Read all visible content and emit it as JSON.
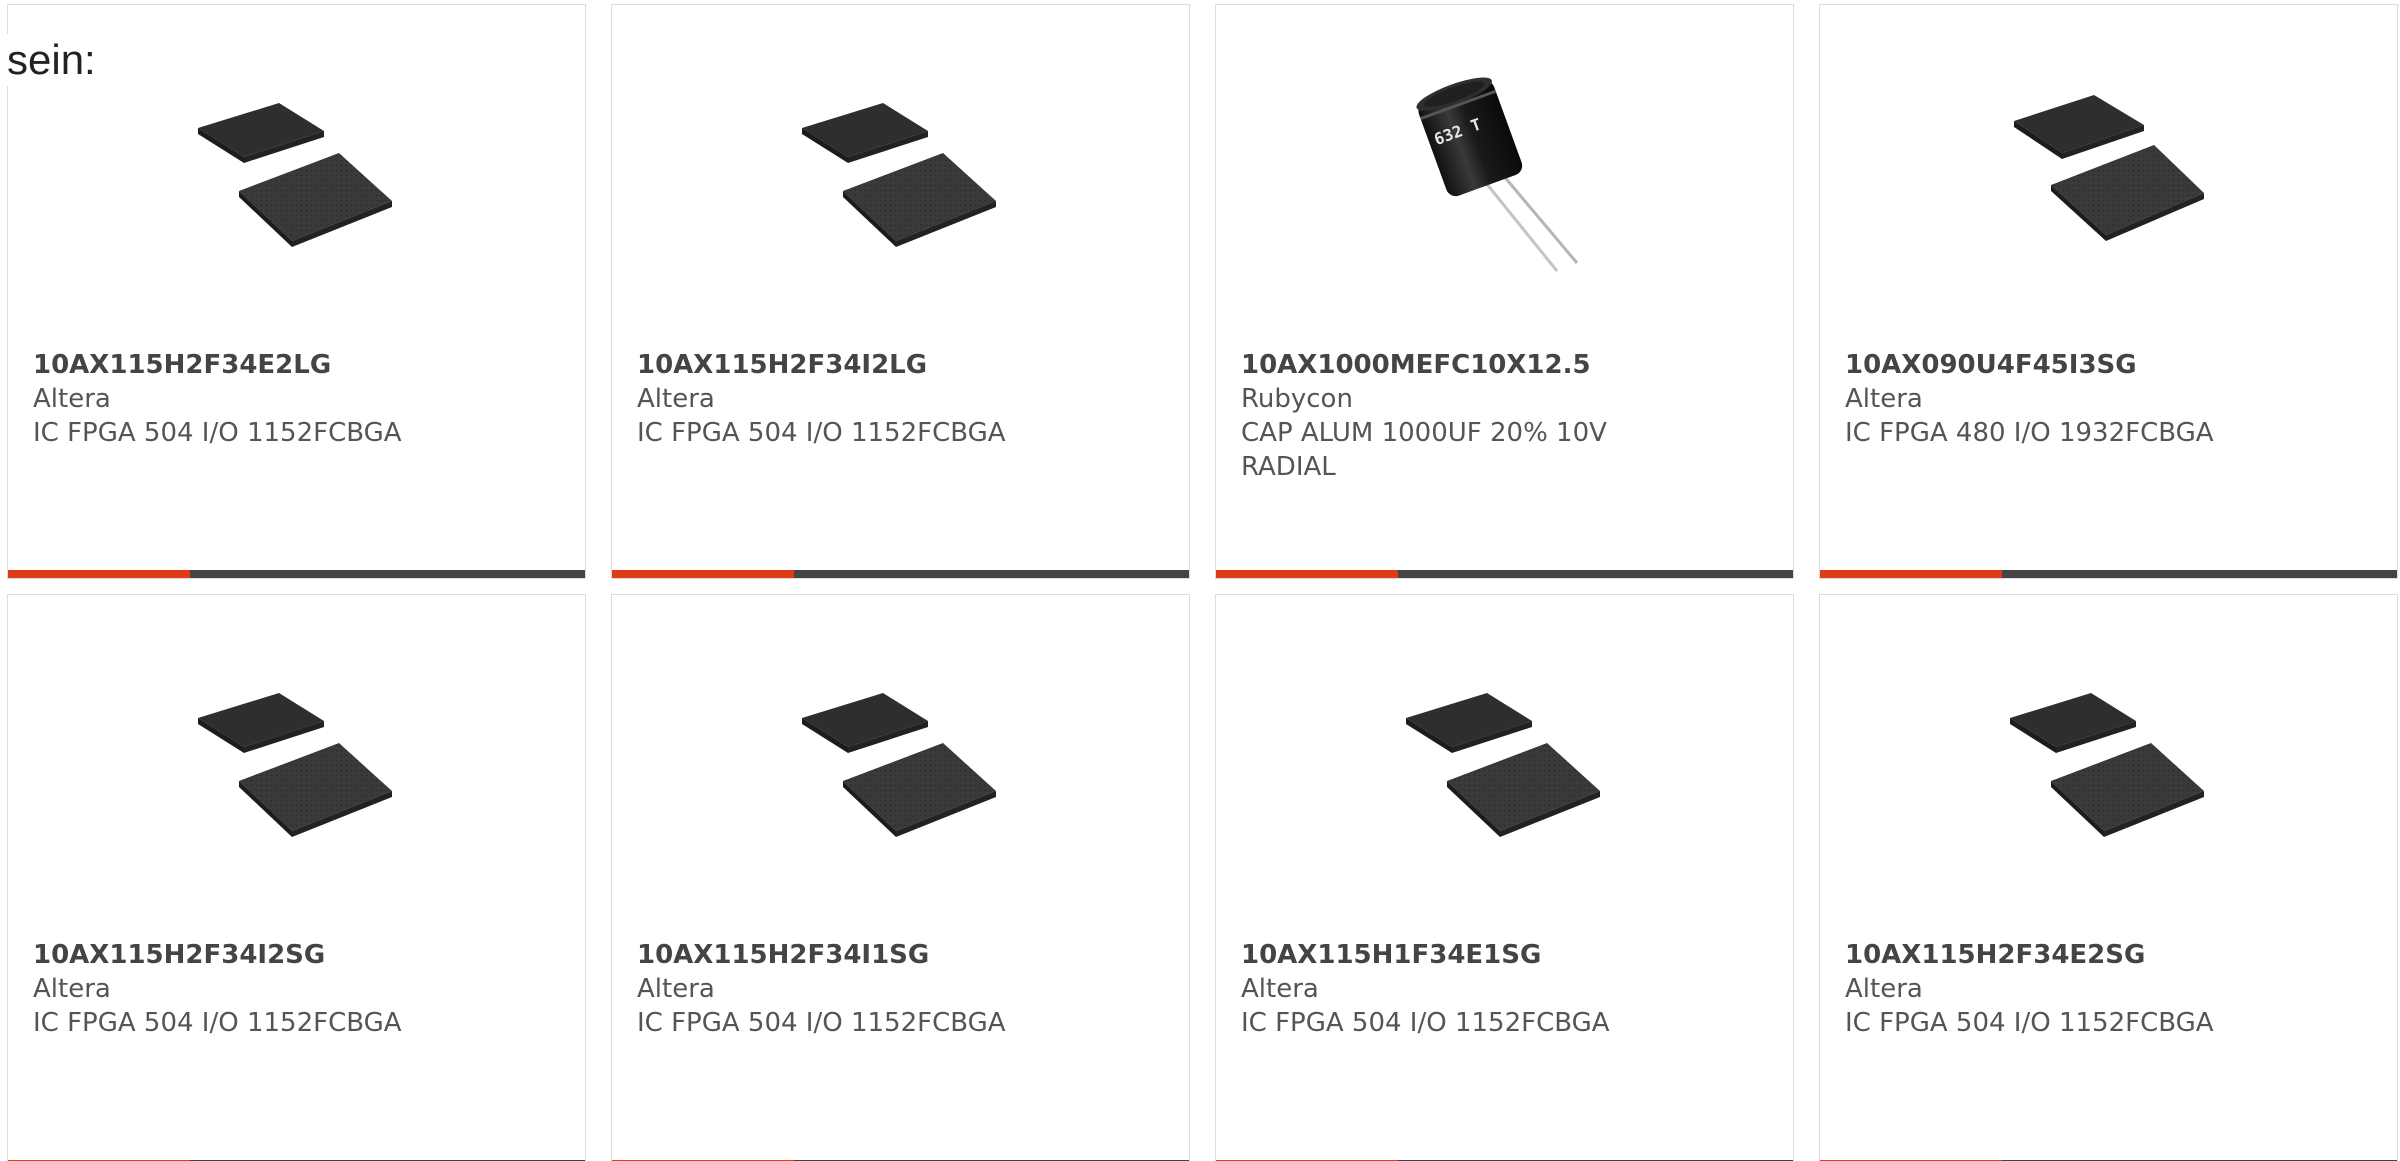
{
  "intro_text": "sein:",
  "colors": {
    "accent": "#e03b15",
    "bar": "#444444",
    "border": "#dcdcdc"
  },
  "products": [
    {
      "part_number": "10AX115H2F34E2LG",
      "manufacturer": "Altera",
      "description": "IC FPGA 504 I/O 1152FCBGA",
      "image_icon": "fpga-chip-icon"
    },
    {
      "part_number": "10AX115H2F34I2LG",
      "manufacturer": "Altera",
      "description": "IC FPGA 504 I/O 1152FCBGA",
      "image_icon": "fpga-chip-icon"
    },
    {
      "part_number": "10AX1000MEFC10X12.5",
      "manufacturer": "Rubycon",
      "description": "CAP ALUM 1000UF 20% 10V RADIAL",
      "image_icon": "capacitor-icon"
    },
    {
      "part_number": "10AX090U4F45I3SG",
      "manufacturer": "Altera",
      "description": "IC FPGA 480 I/O 1932FCBGA",
      "image_icon": "fpga-chip-icon"
    },
    {
      "part_number": "10AX115H2F34I2SG",
      "manufacturer": "Altera",
      "description": "IC FPGA 504 I/O 1152FCBGA",
      "image_icon": "fpga-chip-icon"
    },
    {
      "part_number": "10AX115H2F34I1SG",
      "manufacturer": "Altera",
      "description": "IC FPGA 504 I/O 1152FCBGA",
      "image_icon": "fpga-chip-icon"
    },
    {
      "part_number": "10AX115H1F34E1SG",
      "manufacturer": "Altera",
      "description": "IC FPGA 504 I/O 1152FCBGA",
      "image_icon": "fpga-chip-icon"
    },
    {
      "part_number": "10AX115H2F34E2SG",
      "manufacturer": "Altera",
      "description": "IC FPGA 504 I/O 1152FCBGA",
      "image_icon": "fpga-chip-icon"
    }
  ]
}
